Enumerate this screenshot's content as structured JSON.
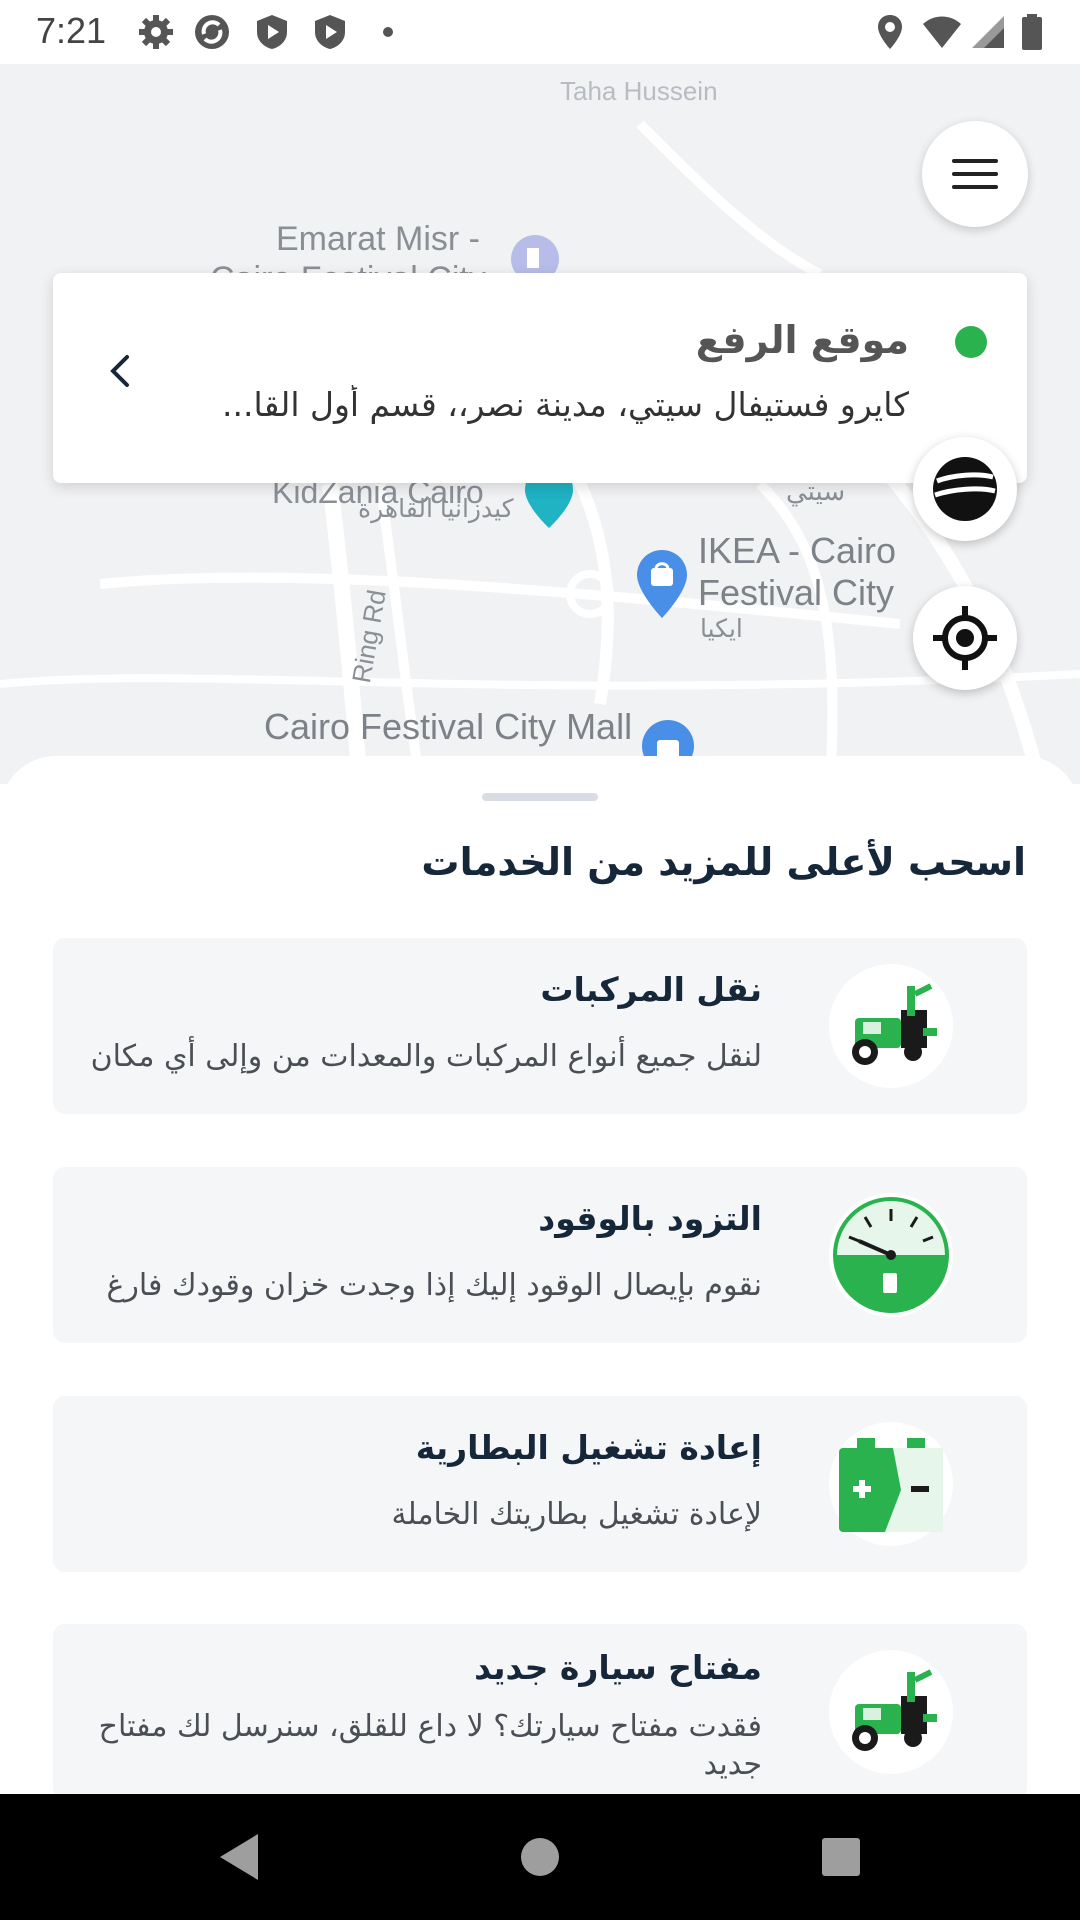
{
  "status_bar": {
    "time": "7:21",
    "icons": [
      "settings-icon",
      "sync-icon",
      "shield-icon",
      "shield-icon",
      "dot-icon",
      "location-icon",
      "wifi-icon",
      "signal-icon",
      "battery-icon"
    ]
  },
  "map": {
    "labels": {
      "top": "Taha Hussein",
      "emarat_line1": "Emarat Misr -",
      "emarat_line2": "Cairo Festival City",
      "kidzania_en": "KidZania Cairo",
      "kidzania_ar": "كيدزانيا القاهرة",
      "city_ar": "سيتي",
      "ikea_line1": "IKEA - Cairo",
      "ikea_line2": "Festival City",
      "ikea_ar": "ايكيا",
      "ring_rd": "Ring Rd",
      "mall": "Cairo Festival City Mall"
    }
  },
  "pickup": {
    "label": "موقع الرفع",
    "address": "كايرو فستيفال سيتي، مدينة نصر،، قسم أول القا...",
    "dot_color": "#2ab24f"
  },
  "sheet": {
    "title": "اسحب لأعلى للمزيد من الخدمات",
    "services": [
      {
        "title": "نقل المركبات",
        "desc": "لنقل جميع أنواع المركبات والمعدات من وإلى أي مكان",
        "icon": "tow-truck-icon"
      },
      {
        "title": "التزود بالوقود",
        "desc": "نقوم بإيصال الوقود إليك إذا وجدت خزان وقودك فارغ",
        "icon": "fuel-gauge-icon"
      },
      {
        "title": "إعادة تشغيل البطارية",
        "desc": "لإعادة تشغيل بطاريتك الخاملة",
        "icon": "battery-icon"
      },
      {
        "title": "مفتاح سيارة جديد",
        "desc": "فقدت مفتاح سيارتك؟ لا داع للقلق، سنرسل لك مفتاح جديد",
        "icon": "tow-truck-icon"
      }
    ]
  },
  "colors": {
    "accent_green": "#2ab24f",
    "dark_text": "#16273a"
  }
}
